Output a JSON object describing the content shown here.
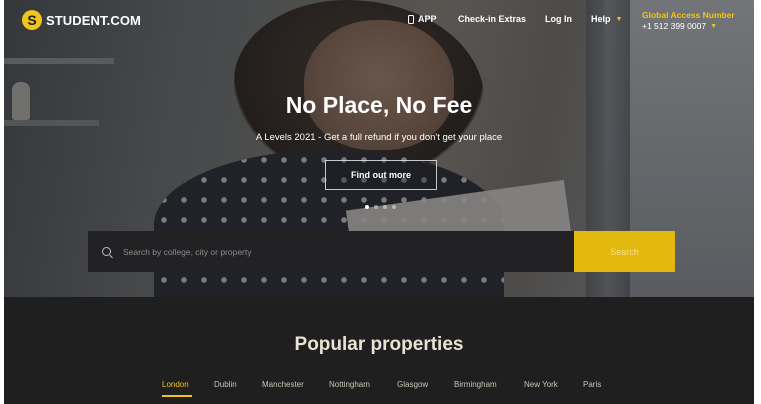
{
  "brand": {
    "logo_letter": "S",
    "name": "STUDENT.COM"
  },
  "nav": {
    "app": "APP",
    "checkin": "Check-in Extras",
    "login": "Log In",
    "help": "Help",
    "global_label": "Global Access Number",
    "global_phone": "+1 512 399 0007"
  },
  "hero": {
    "title": "No Place, No Fee",
    "subtitle": "A Levels 2021 - Get a full refund if you don't get your place",
    "cta": "Find out more",
    "carousel_slides": 4,
    "carousel_active": 1
  },
  "search": {
    "placeholder": "Search by college, city or property",
    "button": "Search"
  },
  "popular": {
    "title": "Popular properties",
    "tabs": [
      "London",
      "Dublin",
      "Manchester",
      "Nottingham",
      "Glasgow",
      "Birmingham",
      "New York",
      "Paris"
    ],
    "active_tab": "London"
  },
  "colors": {
    "accent": "#f0c419",
    "search_button": "#e3b80f",
    "dark_background": "#1f1f20"
  },
  "icons": [
    "phone-icon",
    "chevron-down-icon",
    "search-icon"
  ]
}
